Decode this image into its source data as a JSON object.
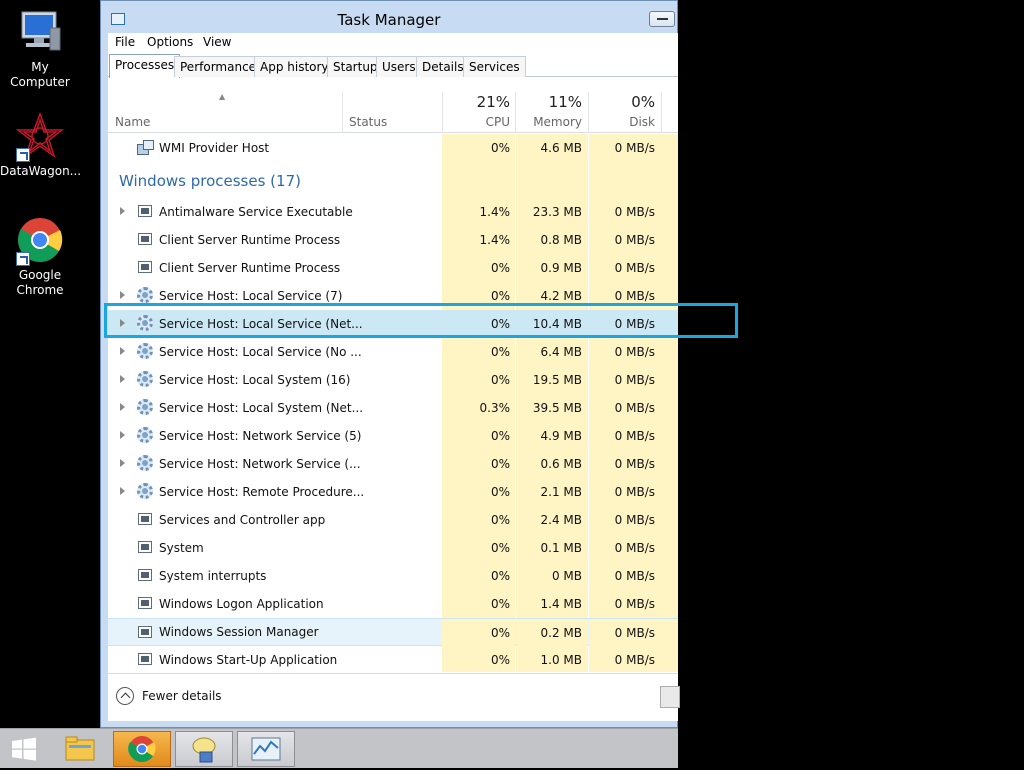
{
  "desktop": {
    "icons": [
      {
        "label": "My Computer",
        "icon": "computer-icon"
      },
      {
        "label": "DataWagon...",
        "icon": "datawagon-logo-icon"
      },
      {
        "label": "Google Chrome",
        "icon": "chrome-icon"
      }
    ]
  },
  "window": {
    "title": "Task Manager"
  },
  "menu": [
    "File",
    "Options",
    "View"
  ],
  "tabs": [
    "Processes",
    "Performance",
    "App history",
    "Startup",
    "Users",
    "Details",
    "Services"
  ],
  "active_tab": "Processes",
  "columns": {
    "name": "Name",
    "status": "Status",
    "cpu": {
      "percent": "21%",
      "label": "CPU"
    },
    "memory": {
      "percent": "11%",
      "label": "Memory"
    },
    "disk": {
      "percent": "0%",
      "label": "Disk"
    }
  },
  "top_row": {
    "name": "WMI Provider Host",
    "cpu": "0%",
    "memory": "4.6 MB",
    "disk": "0 MB/s",
    "icon": "wmi-icon"
  },
  "group_title": "Windows processes (17)",
  "processes": [
    {
      "name": "Antimalware Service Executable",
      "cpu": "1.4%",
      "memory": "23.3 MB",
      "disk": "0 MB/s",
      "expandable": true,
      "icon": "process-icon"
    },
    {
      "name": "Client Server Runtime Process",
      "cpu": "1.4%",
      "memory": "0.8 MB",
      "disk": "0 MB/s",
      "expandable": false,
      "icon": "process-icon"
    },
    {
      "name": "Client Server Runtime Process",
      "cpu": "0%",
      "memory": "0.9 MB",
      "disk": "0 MB/s",
      "expandable": false,
      "icon": "process-icon"
    },
    {
      "name": "Service Host: Local Service (7)",
      "cpu": "0%",
      "memory": "4.2 MB",
      "disk": "0 MB/s",
      "expandable": true,
      "icon": "gear-icon"
    },
    {
      "name": "Service Host: Local Service (Net...",
      "cpu": "0%",
      "memory": "10.4 MB",
      "disk": "0 MB/s",
      "expandable": true,
      "icon": "gear-icon",
      "selected": true
    },
    {
      "name": "Service Host: Local Service (No ...",
      "cpu": "0%",
      "memory": "6.4 MB",
      "disk": "0 MB/s",
      "expandable": true,
      "icon": "gear-icon"
    },
    {
      "name": "Service Host: Local System (16)",
      "cpu": "0%",
      "memory": "19.5 MB",
      "disk": "0 MB/s",
      "expandable": true,
      "icon": "gear-icon"
    },
    {
      "name": "Service Host: Local System (Net...",
      "cpu": "0.3%",
      "memory": "39.5 MB",
      "disk": "0 MB/s",
      "expandable": true,
      "icon": "gear-icon"
    },
    {
      "name": "Service Host: Network Service (5)",
      "cpu": "0%",
      "memory": "4.9 MB",
      "disk": "0 MB/s",
      "expandable": true,
      "icon": "gear-icon"
    },
    {
      "name": "Service Host: Network Service (...",
      "cpu": "0%",
      "memory": "0.6 MB",
      "disk": "0 MB/s",
      "expandable": true,
      "icon": "gear-icon"
    },
    {
      "name": "Service Host: Remote Procedure...",
      "cpu": "0%",
      "memory": "2.1 MB",
      "disk": "0 MB/s",
      "expandable": true,
      "icon": "gear-icon"
    },
    {
      "name": "Services and Controller app",
      "cpu": "0%",
      "memory": "2.4 MB",
      "disk": "0 MB/s",
      "expandable": false,
      "icon": "process-icon"
    },
    {
      "name": "System",
      "cpu": "0%",
      "memory": "0.1 MB",
      "disk": "0 MB/s",
      "expandable": false,
      "icon": "process-icon"
    },
    {
      "name": "System interrupts",
      "cpu": "0%",
      "memory": "0 MB",
      "disk": "0 MB/s",
      "expandable": false,
      "icon": "process-icon"
    },
    {
      "name": "Windows Logon Application",
      "cpu": "0%",
      "memory": "1.4 MB",
      "disk": "0 MB/s",
      "expandable": false,
      "icon": "process-icon"
    },
    {
      "name": "Windows Session Manager",
      "cpu": "0%",
      "memory": "0.2 MB",
      "disk": "0 MB/s",
      "expandable": false,
      "icon": "process-icon",
      "hovered": true
    },
    {
      "name": "Windows Start-Up Application",
      "cpu": "0%",
      "memory": "1.0 MB",
      "disk": "0 MB/s",
      "expandable": false,
      "icon": "process-icon"
    }
  ],
  "footer": {
    "fewer_details": "Fewer details"
  },
  "taskbar": {
    "items": [
      {
        "name": "start-button",
        "icon": "windows-logo-icon"
      },
      {
        "name": "file-explorer",
        "icon": "folder-icon"
      },
      {
        "name": "google-chrome",
        "icon": "chrome-icon"
      },
      {
        "name": "messenger",
        "icon": "chat-icon"
      },
      {
        "name": "task-manager",
        "icon": "task-manager-icon"
      }
    ]
  },
  "colors": {
    "highlight": "#1ba6e0",
    "heat": "#fff4c4",
    "group_title": "#2e6aa8",
    "selected_row": "#cce8f5"
  }
}
